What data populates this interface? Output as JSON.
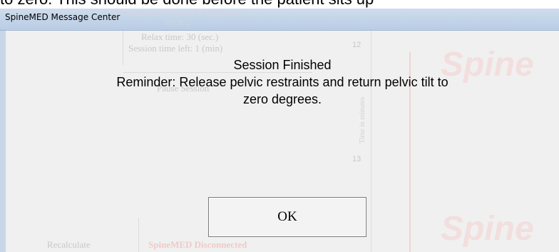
{
  "background_caption": "to zero. This should be done before the patient sits up",
  "window": {
    "title": "SpineMED Message Center"
  },
  "background_app": {
    "status_line1": "Session can be paused. Regressive",
    "status_line2": "cycle 2",
    "relax_time": "Relax time: 30 (sec.)",
    "session_left": "Session time left: 1 (min)",
    "pause_button": "Pause Session",
    "recalculate_button": "Recalculate",
    "device_status": "SpineMED Disconnected",
    "axis_label": "Time in minutes",
    "axis_ticks": [
      "12",
      "13"
    ],
    "watermark": "Spine"
  },
  "dialog": {
    "heading": "Session Finished",
    "reminder_line1": "Reminder: Release pelvic restraints and return pelvic tilt to",
    "reminder_line2": "zero degrees.",
    "ok_label": "OK"
  }
}
